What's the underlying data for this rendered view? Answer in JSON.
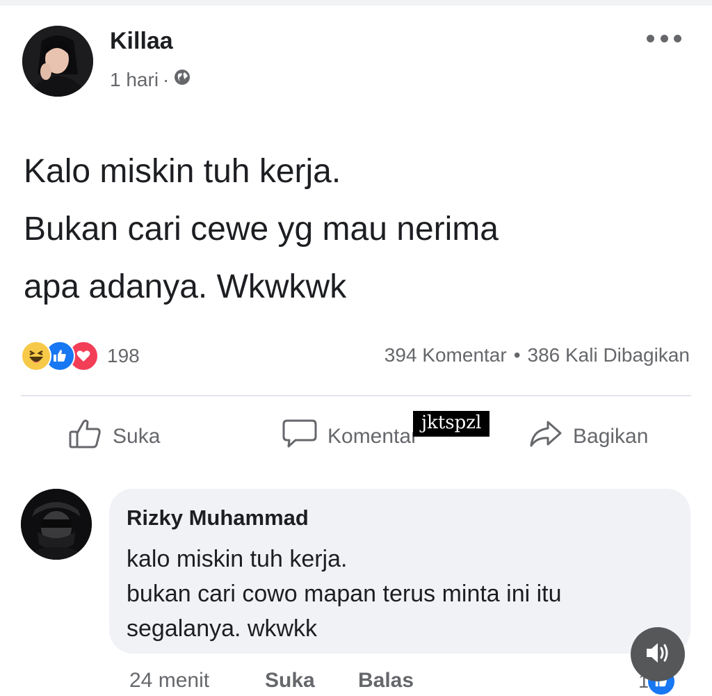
{
  "post": {
    "author": "Killaa",
    "time": "1 hari",
    "separator": "·",
    "privacy_icon": "globe-icon",
    "more_icon": "more-horizontal-icon",
    "text_lines": [
      "Kalo miskin tuh kerja.",
      "Bukan cari cewe yg mau nerima",
      "apa adanya. Wkwkwk"
    ]
  },
  "reactions": {
    "icons": [
      "haha-icon",
      "like-icon",
      "love-icon"
    ],
    "count": "198"
  },
  "stats": {
    "comments": "394 Komentar",
    "separator": "•",
    "shares": "386 Kali Dibagikan"
  },
  "actions": {
    "like": "Suka",
    "comment": "Komentar",
    "share": "Bagikan"
  },
  "watermark": "jktspzl",
  "comment": {
    "author": "Rizky Muhammad",
    "text_lines": [
      "kalo miskin tuh kerja.",
      "bukan cari cowo mapan terus minta ini itu",
      "segalanya. wkwkk"
    ],
    "time": "24 menit",
    "like": "Suka",
    "reply": "Balas",
    "reaction_count": "1"
  },
  "colors": {
    "accent": "#1877f2",
    "text": "#1c1e21",
    "secondary": "#65676b",
    "bubble": "#f0f2f5"
  }
}
